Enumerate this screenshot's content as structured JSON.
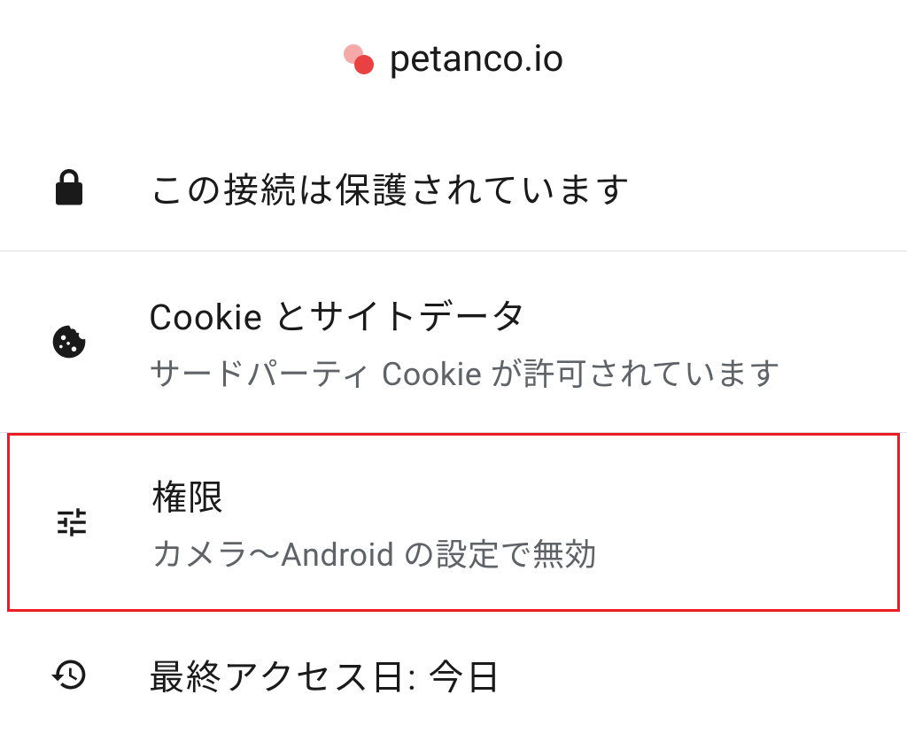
{
  "header": {
    "site": "petanco.io"
  },
  "rows": {
    "connection": {
      "title": "この接続は保護されています"
    },
    "cookies": {
      "title": "Cookie とサイトデータ",
      "subtitle": "サードパーティ Cookie が許可されています"
    },
    "permissions": {
      "title": "権限",
      "subtitle": "カメラ～Android の設定で無効"
    },
    "last_access": {
      "title": "最終アクセス日: 今日"
    }
  }
}
